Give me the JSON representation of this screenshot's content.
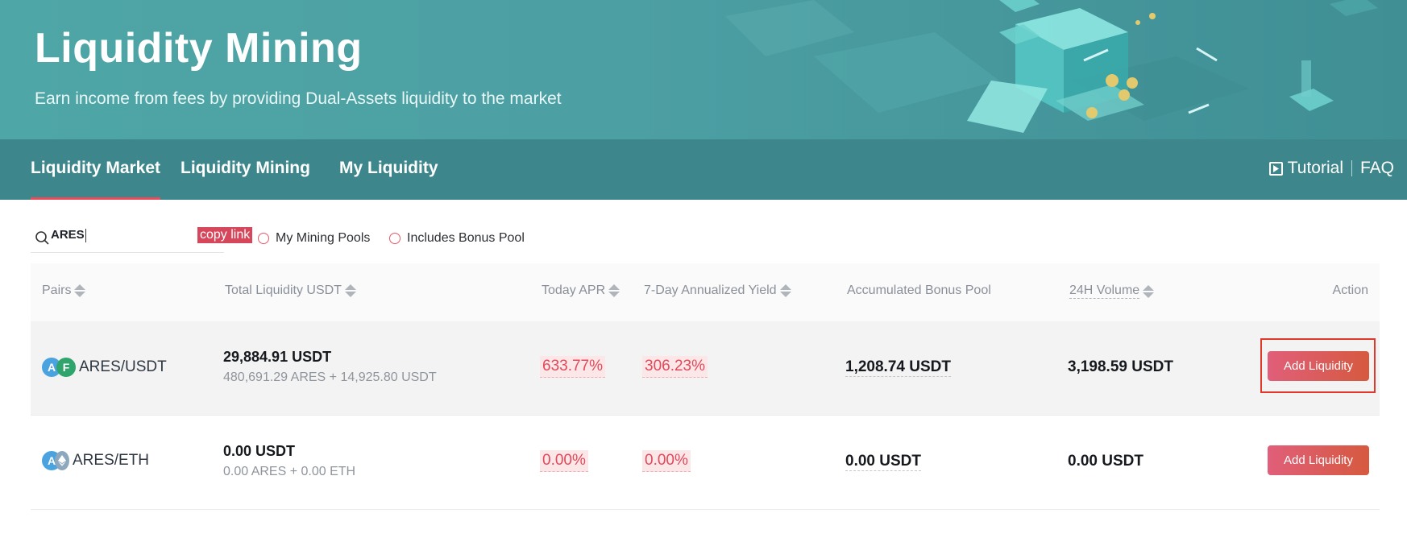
{
  "hero": {
    "title": "Liquidity Mining",
    "subtitle": "Earn income from fees by providing Dual-Assets liquidity to the market"
  },
  "nav": {
    "tabs": [
      {
        "label": "Liquidity Market",
        "active": true
      },
      {
        "label": "Liquidity Mining",
        "active": false
      },
      {
        "label": "My Liquidity",
        "active": false
      }
    ],
    "tutorial": "Tutorial",
    "faq": "FAQ"
  },
  "filters": {
    "search_value": "ARES",
    "copy_link": "copy link",
    "my_mining_pools": "My Mining Pools",
    "includes_bonus_pool": "Includes Bonus Pool"
  },
  "table": {
    "headers": {
      "pairs": "Pairs",
      "total_liquidity": "Total Liquidity USDT",
      "today_apr": "Today APR",
      "yield_7day": "7-Day Annualized Yield",
      "bonus_pool": "Accumulated Bonus Pool",
      "volume_24h": "24H Volume",
      "action": "Action"
    },
    "rows": [
      {
        "coin_a": "A",
        "coin_b": "F",
        "pair": "ARES/USDT",
        "liquidity": "29,884.91 USDT",
        "liquidity_detail": "480,691.29 ARES + 14,925.80 USDT",
        "today_apr": "633.77%",
        "yield_7day": "306.23%",
        "bonus_pool": "1,208.74 USDT",
        "volume_24h": "3,198.59 USDT",
        "action": "Add Liquidity"
      },
      {
        "coin_a": "A",
        "coin_b": "",
        "pair": "ARES/ETH",
        "liquidity": "0.00 USDT",
        "liquidity_detail": "0.00 ARES + 0.00 ETH",
        "today_apr": "0.00%",
        "yield_7day": "0.00%",
        "bonus_pool": "0.00 USDT",
        "volume_24h": "0.00 USDT",
        "action": "Add Liquidity"
      }
    ]
  },
  "colors": {
    "accent": "#e2495a",
    "banner": "#4fa6a6",
    "navbar": "#3d878c"
  }
}
